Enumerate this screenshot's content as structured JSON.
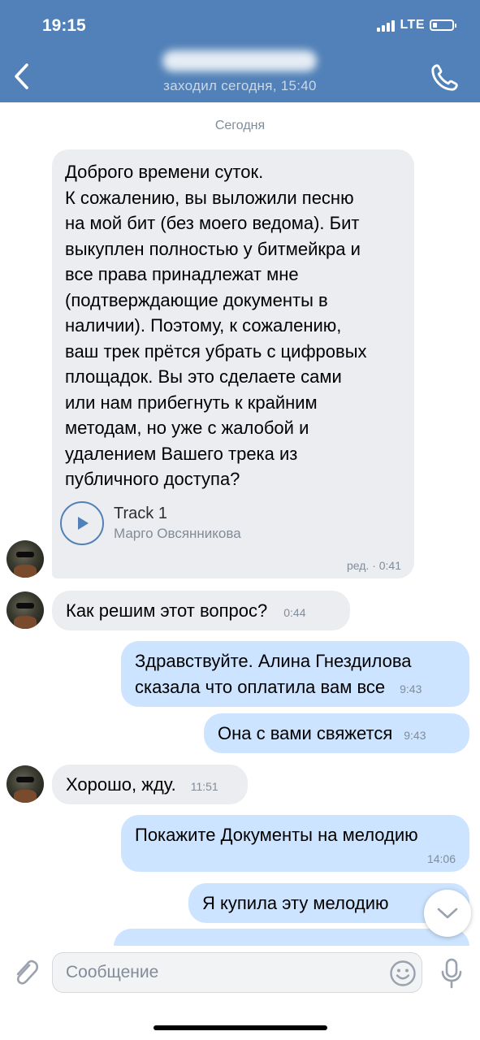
{
  "status_bar": {
    "time": "19:15",
    "network": "LTE"
  },
  "header": {
    "last_seen": "заходил сегодня, 15:40"
  },
  "chat": {
    "date_separator": "Сегодня",
    "messages": [
      {
        "lines": [
          "Доброго времени суток.",
          "К сожалению, вы выложили песню",
          "на мой бит (без моего ведома). Бит",
          "выкуплен полностью у битмейкра и",
          "все права принадлежат мне",
          "(подтверждающие документы в",
          "наличии). Поэтому, к сожалению,",
          "ваш трек прётся убрать с цифровых",
          "площадок. Вы это сделаете сами",
          "или нам прибегнуть к крайним",
          "методам, но уже с жалобой и",
          "удалением Вашего трека из",
          "публичного доступа?"
        ],
        "audio_title": "Track 1",
        "audio_artist": "Марго Овсянникова",
        "time": "ред. · 0:41"
      },
      {
        "text": "Как решим этот вопрос?",
        "time": "0:44"
      },
      {
        "line1": "Здравствуйте. Алина Гнездилова",
        "line2": "сказала что оплатила вам все",
        "time": "9:43"
      },
      {
        "text": "Она с вами свяжется",
        "time": "9:43"
      },
      {
        "text": "Хорошо, жду.",
        "time": "11:51"
      },
      {
        "text": "Покажите Документы на мелодию",
        "time": "14:06"
      },
      {
        "text": "Я купила эту мелодию"
      }
    ]
  },
  "composer": {
    "placeholder": "Сообщение"
  },
  "icons": {
    "back": "chevron-left-icon",
    "call": "phone-icon",
    "play": "play-icon",
    "scroll_down": "chevron-down-icon",
    "attach": "paperclip-icon",
    "emoji": "smile-icon",
    "mic": "microphone-icon"
  },
  "colors": {
    "accent": "#5181b8",
    "incoming_bubble": "#ebedf0",
    "outgoing_bubble": "#cce4ff",
    "secondary_text": "#818c99"
  }
}
